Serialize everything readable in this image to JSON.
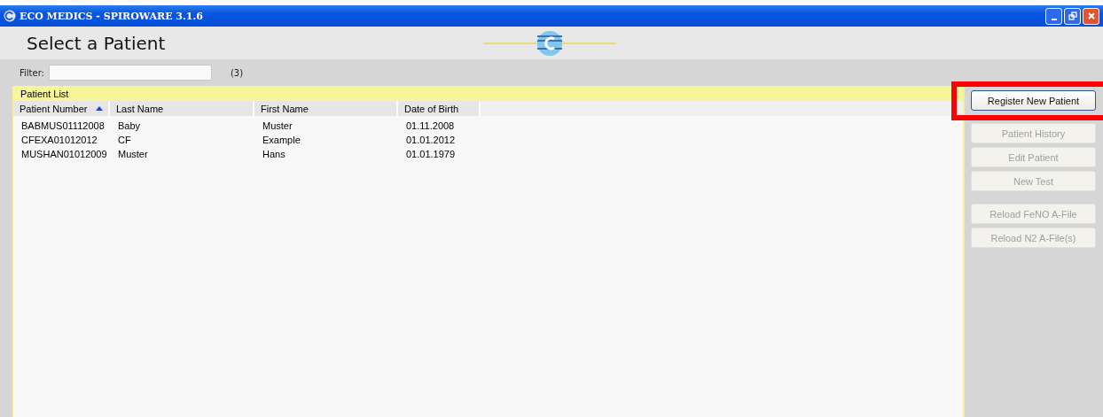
{
  "window": {
    "title": "ECO MEDICS - SPIROWARE 3.1.6"
  },
  "header": {
    "title": "Select a Patient"
  },
  "filter": {
    "label": "Filter:",
    "count": "(3)"
  },
  "patient_list": {
    "title": "Patient List",
    "columns": [
      {
        "label": "Patient Number",
        "sorted": true
      },
      {
        "label": "Last Name",
        "sorted": false
      },
      {
        "label": "First Name",
        "sorted": false
      },
      {
        "label": "Date of Birth",
        "sorted": false
      }
    ],
    "rows": [
      {
        "cells": [
          "BABMUS01112008",
          "Baby",
          "Muster",
          "01.11.2008"
        ]
      },
      {
        "cells": [
          "CFEXA01012012",
          "CF",
          "Example",
          "01.01.2012"
        ]
      },
      {
        "cells": [
          "MUSHAN01012009",
          "Muster",
          "Hans",
          "01.01.1979"
        ]
      }
    ]
  },
  "action_groups": [
    [
      {
        "label": "Register New Patient",
        "disabled": false,
        "highlighted": true
      }
    ],
    [
      {
        "label": "Patient History",
        "disabled": true,
        "highlighted": false
      },
      {
        "label": "Edit Patient",
        "disabled": true,
        "highlighted": false
      },
      {
        "label": "New Test",
        "disabled": true,
        "highlighted": false
      }
    ],
    [
      {
        "label": "Reload FeNO A-File",
        "disabled": true,
        "highlighted": false
      },
      {
        "label": "Reload N2 A-File(s)",
        "disabled": true,
        "highlighted": false
      }
    ]
  ]
}
